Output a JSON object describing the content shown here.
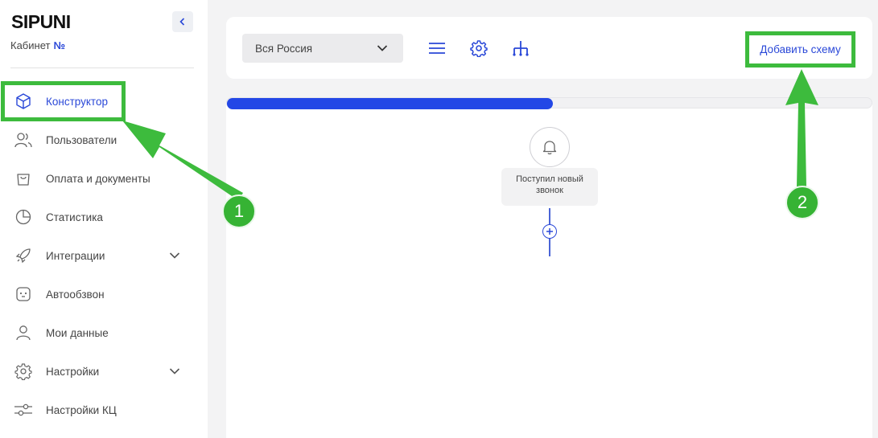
{
  "app": {
    "logo": "SIPUNI",
    "cabinet_label": "Кабинет",
    "cabinet_number": "№"
  },
  "sidebar": {
    "items": [
      {
        "label": "Конструктор",
        "icon": "cube-icon",
        "active": true
      },
      {
        "label": "Пользователи",
        "icon": "users-icon"
      },
      {
        "label": "Оплата и документы",
        "icon": "bag-icon"
      },
      {
        "label": "Статистика",
        "icon": "pie-chart-icon"
      },
      {
        "label": "Интеграции",
        "icon": "rocket-icon",
        "expandable": true
      },
      {
        "label": "Автообзвон",
        "icon": "robot-icon"
      },
      {
        "label": "Мои данные",
        "icon": "user-icon"
      },
      {
        "label": "Настройки",
        "icon": "gear-icon",
        "expandable": true
      },
      {
        "label": "Настройки КЦ",
        "icon": "sliders-icon"
      }
    ]
  },
  "toolbar": {
    "region_value": "Вся Россия",
    "add_scheme_label": "Добавить схему"
  },
  "canvas": {
    "progress_percent": 50.5,
    "start_node_label": "Поступил новый звонок"
  },
  "annotations": {
    "marker_1": "1",
    "marker_2": "2"
  },
  "colors": {
    "accent": "#2a48d8",
    "progress": "#2347e6",
    "highlight": "#3dbb3d"
  }
}
